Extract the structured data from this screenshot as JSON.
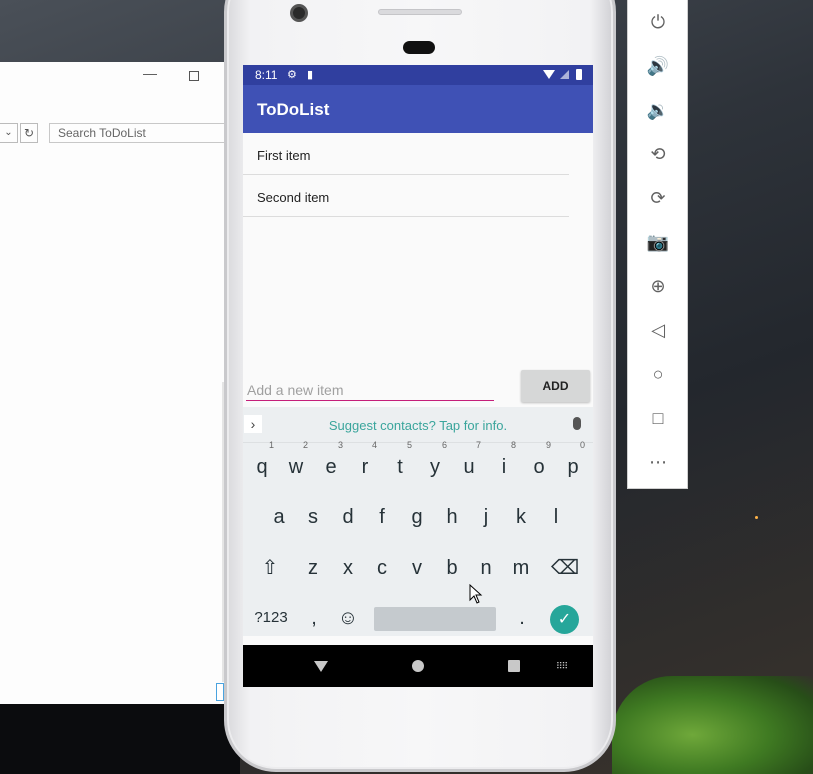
{
  "explorer": {
    "search_placeholder": "Search ToDoList"
  },
  "status_bar": {
    "time": "8:11"
  },
  "app": {
    "title": "ToDoList",
    "items": [
      "First item",
      "Second item"
    ],
    "new_item_placeholder": "Add a new item",
    "add_button_label": "ADD",
    "accent_color": "#3f51b5",
    "underline_color": "#c51f7a"
  },
  "keyboard": {
    "suggestion": "Suggest contacts? Tap for info.",
    "row1": [
      {
        "key": "q",
        "hint": "1"
      },
      {
        "key": "w",
        "hint": "2"
      },
      {
        "key": "e",
        "hint": "3"
      },
      {
        "key": "r",
        "hint": "4"
      },
      {
        "key": "t",
        "hint": "5"
      },
      {
        "key": "y",
        "hint": "6"
      },
      {
        "key": "u",
        "hint": "7"
      },
      {
        "key": "i",
        "hint": "8"
      },
      {
        "key": "o",
        "hint": "9"
      },
      {
        "key": "p",
        "hint": "0"
      }
    ],
    "row2": [
      "a",
      "s",
      "d",
      "f",
      "g",
      "h",
      "j",
      "k",
      "l"
    ],
    "row3": [
      "z",
      "x",
      "c",
      "v",
      "b",
      "n",
      "m"
    ],
    "symbols_label": "?123",
    "comma": ",",
    "period": "."
  },
  "emulator_toolbar": [
    "power-icon",
    "volume-up-icon",
    "volume-down-icon",
    "rotate-left-icon",
    "rotate-right-icon",
    "camera-icon",
    "zoom-icon",
    "back-icon",
    "home-icon",
    "overview-icon",
    "more-icon"
  ]
}
